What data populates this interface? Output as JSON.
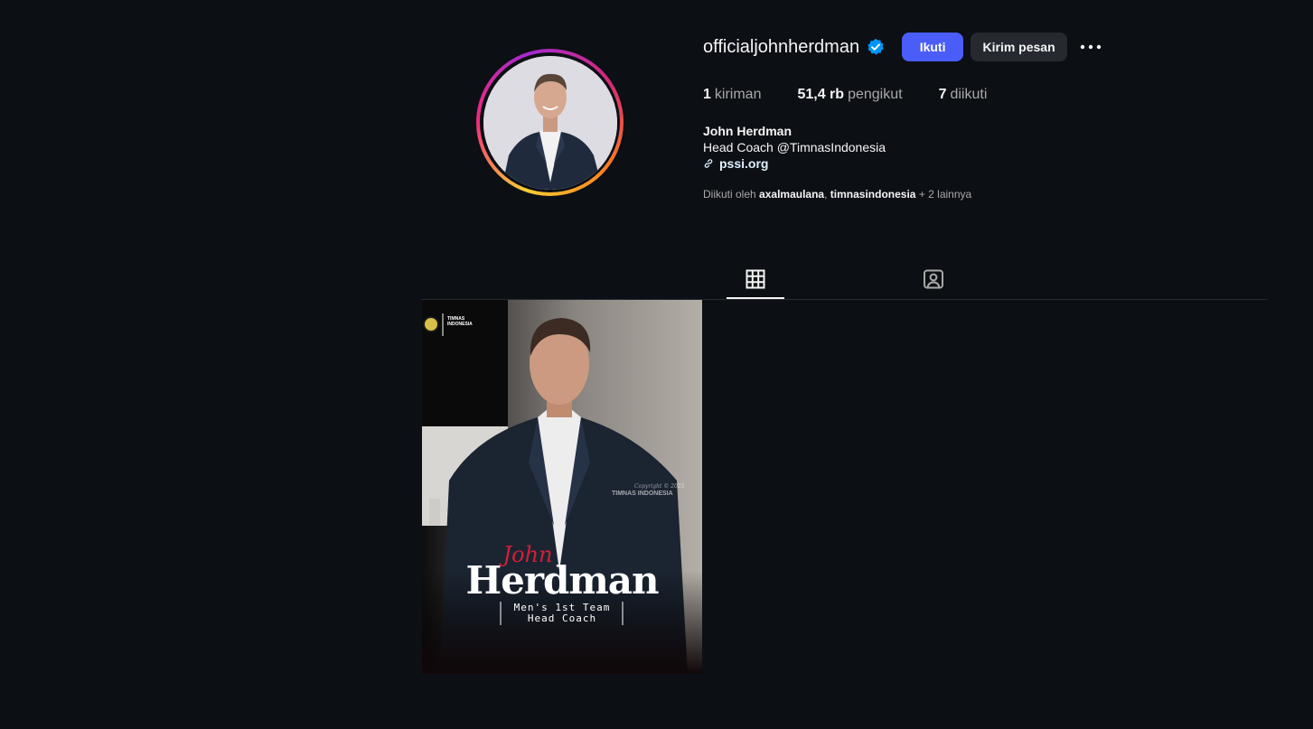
{
  "profile": {
    "username": "officialjohnherdman",
    "verified": true,
    "follow_label": "Ikuti",
    "message_label": "Kirim pesan",
    "more_icon": "more-horizontal-icon"
  },
  "stats": {
    "posts_count": "1",
    "posts_label": "kiriman",
    "followers_count": "51,4 rb",
    "followers_label": "pengikut",
    "following_count": "7",
    "following_label": "diikuti"
  },
  "bio": {
    "full_name": "John Herdman",
    "description": "Head Coach @TimnasIndonesia",
    "link": "pssi.org"
  },
  "followed_by": {
    "prefix": "Diikuti oleh",
    "user1": "axalmaulana",
    "separator": ",",
    "user2": "timnasindonesia",
    "suffix": "+ 2 lainnya"
  },
  "tabs": [
    {
      "icon": "grid-icon",
      "active": true
    },
    {
      "icon": "tagged-icon",
      "active": false
    }
  ],
  "post": {
    "script_name": "John",
    "surname": "Herdman",
    "role_line1": "Men's 1st Team",
    "role_line2": "Head Coach",
    "watermark": "TIMNAS INDONESIA",
    "brand_mark": "TIMNAS INDONESIA",
    "copyright": "Copyright © 2025"
  },
  "colors": {
    "background": "#0c0f14",
    "follow_button": "#4a5df9",
    "secondary_button": "#262a30",
    "verified_badge": "#0095f6"
  }
}
